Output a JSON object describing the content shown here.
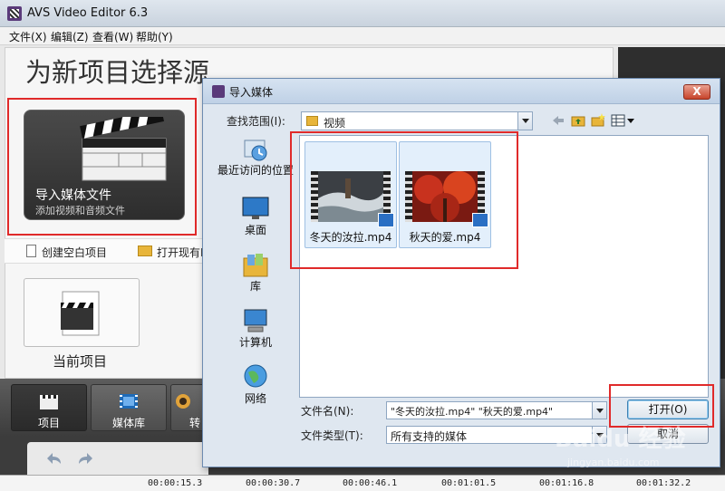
{
  "app": {
    "title": "AVS Video Editor 6.3",
    "menu": [
      "文件(X)",
      "编辑(Z)",
      "查看(W)",
      "帮助(Y)"
    ]
  },
  "start_panel": {
    "heading": "为新项目选择源",
    "import_card": {
      "title": "导入媒体文件",
      "subtitle": "添加视频和音频文件"
    },
    "options": {
      "blank": "创建空白项目",
      "open": "打开现有I"
    },
    "current_project": {
      "label": "当前项目"
    }
  },
  "toolbar": {
    "buttons": [
      {
        "label": "项目",
        "icon": "clapperboard-icon",
        "active": true
      },
      {
        "label": "媒体库",
        "icon": "film-icon",
        "active": false
      },
      {
        "label": "转",
        "icon": "transition-icon",
        "active": false
      }
    ]
  },
  "timeline": {
    "ticks": [
      "00:00:15.3",
      "00:00:30.7",
      "00:00:46.1",
      "00:01:01.5",
      "00:01:16.8",
      "00:01:32.2"
    ]
  },
  "dialog": {
    "title": "导入媒体",
    "close_label": "X",
    "look_in_label": "查找范围(I):",
    "look_in_value": "视频",
    "places": [
      "最近访问的位置",
      "桌面",
      "库",
      "计算机",
      "网络"
    ],
    "files": [
      {
        "name": "冬天的汝拉.mp4",
        "thumb": "snow-river"
      },
      {
        "name": "秋天的爱.mp4",
        "thumb": "red-autumn"
      }
    ],
    "file_name_label": "文件名(N):",
    "file_name_value": "\"冬天的汝拉.mp4\" \"秋天的爱.mp4\"",
    "file_type_label": "文件类型(T):",
    "file_type_value": "所有支持的媒体",
    "open_button": "打开(O)",
    "cancel_button": "取消"
  },
  "watermark": {
    "main": "Baidu 经验",
    "sub": "jingyan.baidu.com"
  },
  "colors": {
    "highlight": "#e02a2a",
    "dialog_bg": "#dfe7f0",
    "dark_panel": "#3c3c3c"
  }
}
